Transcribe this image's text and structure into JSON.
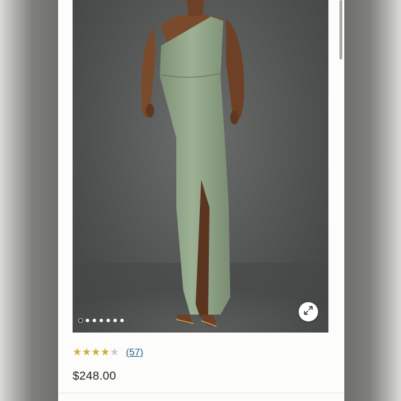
{
  "product": {
    "image_alt": "Sage green one-shoulder satin maxi dress with side slit",
    "carousel_total": 7,
    "carousel_active_index": 0,
    "rating": {
      "value": 4,
      "max": 5,
      "review_count_label": "(57)"
    },
    "price": "$248.00"
  },
  "icons": {
    "expand": "expand-arrows-icon",
    "star": "star-icon"
  },
  "colors": {
    "dress": "#8ea286",
    "backdrop": "#575a58",
    "star_filled": "#c9b037",
    "link": "#1f5f8b"
  }
}
